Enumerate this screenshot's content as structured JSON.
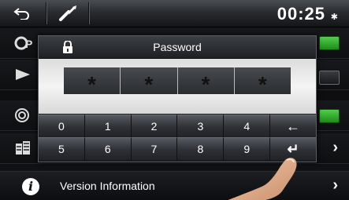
{
  "topbar": {
    "clock": "00:25",
    "bluetooth": "✱"
  },
  "icons": {
    "back": "back-arrow-icon",
    "tools": "wrench-icon"
  },
  "rows": [
    {
      "id": "row-1",
      "icon": "settings-icon",
      "control": "toggle",
      "state": "on"
    },
    {
      "id": "row-2",
      "icon": "play-icon",
      "control": "toggle",
      "state": "off"
    },
    {
      "id": "row-3",
      "icon": "radio-icon",
      "control": "toggle",
      "state": "on"
    },
    {
      "id": "row-4",
      "icon": "grid-icon",
      "control": "chevron"
    }
  ],
  "info_row": {
    "icon": "i",
    "label": "Version Information",
    "chevron": "›"
  },
  "dialog": {
    "title": "Password",
    "masked": [
      "*",
      "*",
      "*",
      "*"
    ],
    "keys_row1": [
      "0",
      "1",
      "2",
      "3",
      "4",
      "←"
    ],
    "keys_row2": [
      "5",
      "6",
      "7",
      "8",
      "9",
      "↵"
    ]
  },
  "colors": {
    "toggle_on": "#3fbf38",
    "toggle_off": "#2a2c30"
  }
}
